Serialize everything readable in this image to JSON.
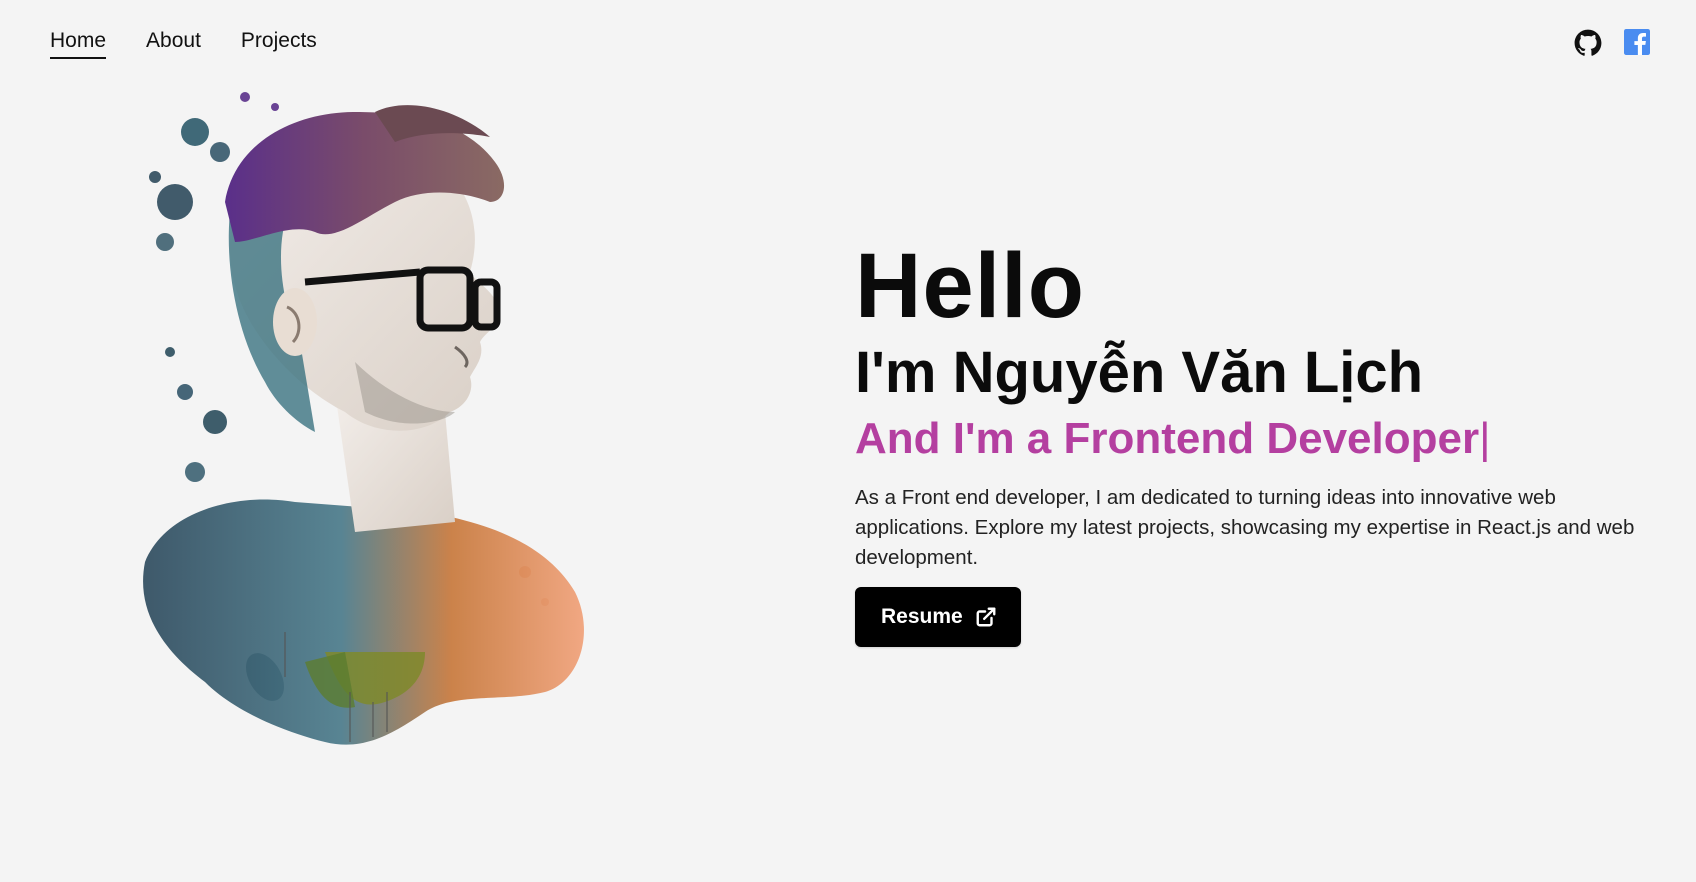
{
  "nav": {
    "items": [
      {
        "label": "Home",
        "active": true
      },
      {
        "label": "About",
        "active": false
      },
      {
        "label": "Projects",
        "active": false
      }
    ]
  },
  "socials": {
    "items": [
      {
        "icon": "github-icon",
        "color": "#111111"
      },
      {
        "icon": "facebook-icon",
        "color": "#4a8cf0"
      }
    ]
  },
  "hero": {
    "greeting": "Hello",
    "name_line": "I'm Nguyễn Văn Lịch",
    "role_line": "And I'm a Frontend Developer",
    "cursor": "|",
    "description": "As a Front end developer, I am dedicated to turning ideas into innovative web applications. Explore my latest projects, showcasing my expertise in React.js and web development.",
    "resume_label": "Resume",
    "role_color": "#b43fa0"
  },
  "portrait": {
    "subject": "watercolor-portrait-man-with-glasses"
  }
}
